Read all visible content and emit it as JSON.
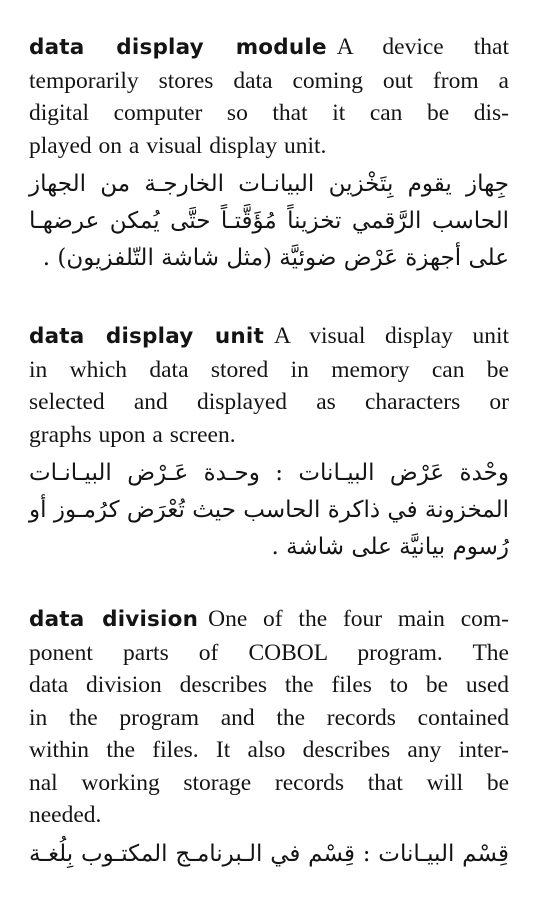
{
  "entries": [
    {
      "term": "data display module",
      "definition_lines": [
        "A device that",
        "temporarily stores data coming out from a",
        "digital computer so that it can be dis-",
        "played on a visual display unit."
      ],
      "arabic_lines": [
        "جِهاز يقوم بِتَخْزين البيانـات الخارجـة من الجهاز",
        "الحاسب الرَّقمي تخزيناً مُؤَقَّتـاً حتَّى يُمكن عرضهـا",
        "على أجهزة عَرْض ضوئيَّة (مثل شاشة التّلفزيون) ."
      ]
    },
    {
      "term": "data display unit",
      "definition_lines": [
        "A visual display unit",
        "in which data stored in memory can be",
        "selected and displayed as characters or",
        "graphs upon a screen."
      ],
      "arabic_lines": [
        "وحْدة عَرْض البيـانات : وحـدة عَـرْض البيـانـات",
        "المخزونة في ذاكرة الحاسب حيث تُعْرَض كرُمـوز أو",
        "رُسوم بيانيَّة على شاشة ."
      ]
    },
    {
      "term": "data division",
      "definition_lines": [
        "One of the four main com-",
        "ponent parts of COBOL program. The",
        "data division describes the files to be used",
        "in the program and the records contained",
        "within the files. It also describes any inter-",
        "nal working storage records that will be",
        "needed."
      ],
      "arabic_lines": [
        "قِسْم البيـانات : قِسْم في الـبرنامـج المكتـوب بِلُغـة"
      ]
    }
  ]
}
